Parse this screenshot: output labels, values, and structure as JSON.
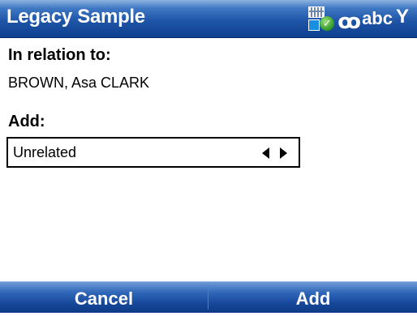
{
  "window": {
    "title": "Legacy Sample"
  },
  "status": {
    "input_mode_icon": "input-method-icon",
    "t9_glyph": "ꝏ",
    "input_mode_text": "abc",
    "signal_icon": "signal-antenna-icon",
    "signal_glyph": "Y"
  },
  "form": {
    "relation_label": "In relation to:",
    "relation_person": "BROWN, Asa CLARK",
    "add_label": "Add:",
    "add_selected": "Unrelated"
  },
  "softkeys": {
    "left": "Cancel",
    "right": "Add"
  }
}
